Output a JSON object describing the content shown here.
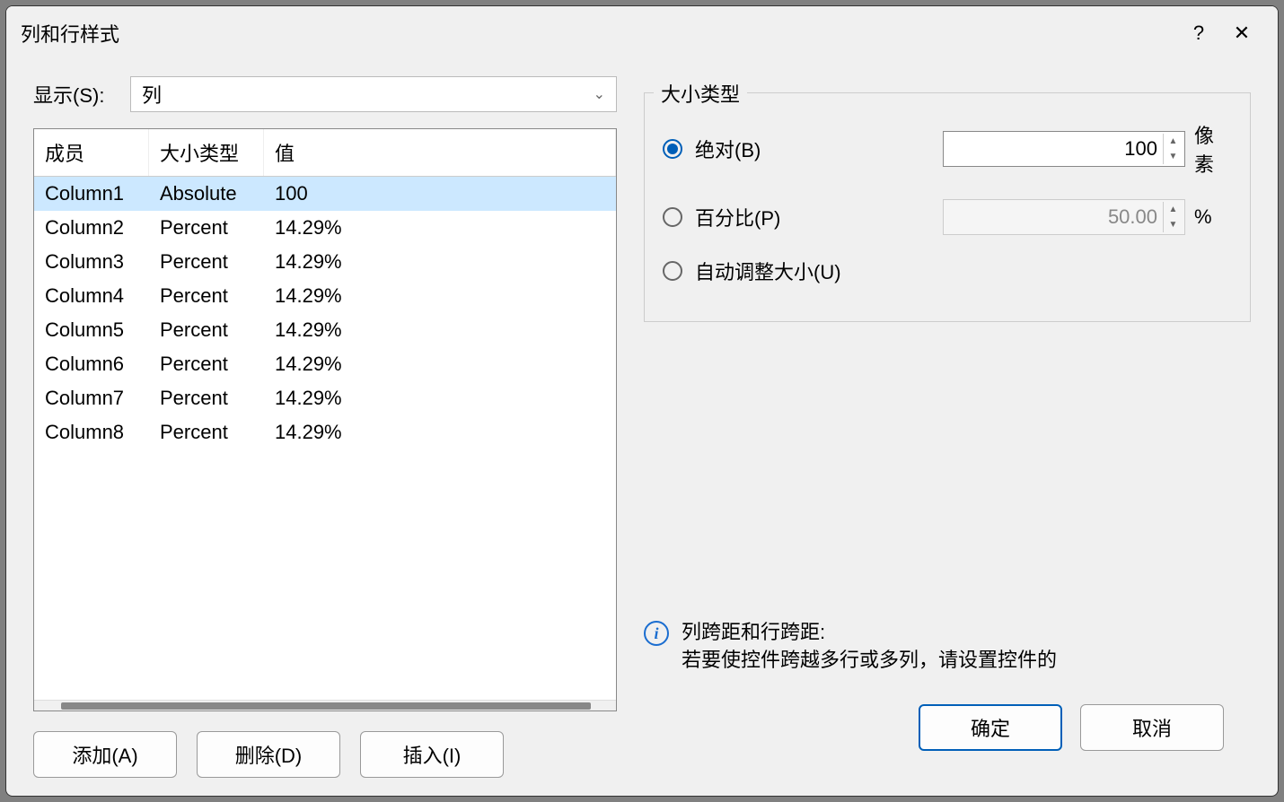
{
  "title": "列和行样式",
  "show": {
    "label": "显示(S):",
    "value": "列"
  },
  "grid": {
    "headers": {
      "member": "成员",
      "type": "大小类型",
      "value": "值"
    },
    "rows": [
      {
        "member": "Column1",
        "type": "Absolute",
        "value": "100",
        "selected": true
      },
      {
        "member": "Column2",
        "type": "Percent",
        "value": "14.29%",
        "selected": false
      },
      {
        "member": "Column3",
        "type": "Percent",
        "value": "14.29%",
        "selected": false
      },
      {
        "member": "Column4",
        "type": "Percent",
        "value": "14.29%",
        "selected": false
      },
      {
        "member": "Column5",
        "type": "Percent",
        "value": "14.29%",
        "selected": false
      },
      {
        "member": "Column6",
        "type": "Percent",
        "value": "14.29%",
        "selected": false
      },
      {
        "member": "Column7",
        "type": "Percent",
        "value": "14.29%",
        "selected": false
      },
      {
        "member": "Column8",
        "type": "Percent",
        "value": "14.29%",
        "selected": false
      }
    ]
  },
  "buttons": {
    "add": "添加(A)",
    "delete": "删除(D)",
    "insert": "插入(I)"
  },
  "sizetype": {
    "group_label": "大小类型",
    "absolute": {
      "label": "绝对(B)",
      "value": "100",
      "unit": "像素",
      "checked": true
    },
    "percent": {
      "label": "百分比(P)",
      "value": "50.00",
      "unit": "%",
      "checked": false
    },
    "auto": {
      "label": "自动调整大小(U)",
      "checked": false
    }
  },
  "info": {
    "heading": "列跨距和行跨距:",
    "body": "若要使控件跨越多行或多列，请设置控件的"
  },
  "footer": {
    "ok": "确定",
    "cancel": "取消"
  },
  "titlebar": {
    "help": "?",
    "close": "✕"
  }
}
